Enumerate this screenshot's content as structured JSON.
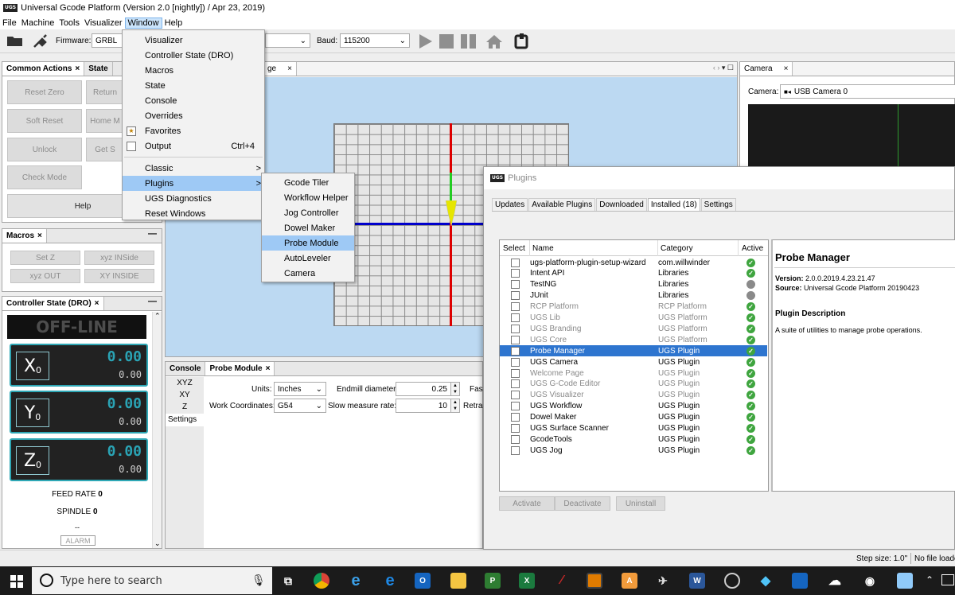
{
  "window": {
    "logo": "UGS",
    "title": "Universal Gcode Platform (Version 2.0 [nightly])  / Apr 23, 2019)"
  },
  "menubar": [
    "File",
    "Machine",
    "Tools",
    "Visualizer",
    "Window",
    "Help"
  ],
  "toolbar": {
    "firmware_label": "Firmware:",
    "firmware_value": "GRBL",
    "baud_label": "Baud:",
    "baud_value": "115200"
  },
  "common_actions": {
    "tab_label": "Common Actions",
    "tab2_label": "State",
    "buttons": [
      "Reset Zero",
      "Return",
      "Soft Reset",
      "Home M",
      "Unlock",
      "Get S",
      "Check Mode"
    ],
    "help_label": "Help"
  },
  "macros": {
    "tab_label": "Macros",
    "buttons": [
      "Set Z",
      "xyz INSide",
      "xyz OUT",
      "XY INSIDE"
    ]
  },
  "dro": {
    "tab_label": "Controller State (DRO)",
    "status": "OFF-LINE",
    "axes": [
      {
        "name": "X",
        "sub": "0",
        "work": "0.00",
        "machine": "0.00"
      },
      {
        "name": "Y",
        "sub": "0",
        "work": "0.00",
        "machine": "0.00"
      },
      {
        "name": "Z",
        "sub": "0",
        "work": "0.00",
        "machine": "0.00"
      }
    ],
    "feed_rate_label": "FEED RATE",
    "feed_rate_value": "0",
    "spindle_label": "SPINDLE",
    "spindle_value": "0",
    "dashes": "--",
    "alarm": "ALARM"
  },
  "window_menu": {
    "items": [
      {
        "label": "Visualizer"
      },
      {
        "label": "Controller State (DRO)"
      },
      {
        "label": "Macros"
      },
      {
        "label": "State"
      },
      {
        "label": "Console"
      },
      {
        "label": "Overrides"
      },
      {
        "label": "Favorites"
      },
      {
        "label": "Output",
        "shortcut": "Ctrl+4"
      },
      {
        "label": "Classic",
        "submenu": true
      },
      {
        "label": "Plugins",
        "submenu": true
      },
      {
        "label": "UGS Diagnostics"
      },
      {
        "label": "Reset Windows"
      }
    ],
    "submenu_arrow": ">"
  },
  "plugins_menu": [
    "Gcode Tiler",
    "Workflow Helper",
    "Jog Controller",
    "Dowel Maker",
    "Probe Module",
    "AutoLeveler",
    "Camera"
  ],
  "visualizer": {
    "tab_label": "ge"
  },
  "camera": {
    "tab_label": "Camera",
    "camera_label": "Camera:",
    "camera_value": "USB Camera 0"
  },
  "bottom_panel": {
    "tabs": [
      "Console",
      "Probe Module"
    ],
    "side_tabs": [
      "XYZ",
      "XY",
      "Z",
      "Settings"
    ],
    "units_label": "Units:",
    "units_value": "Inches",
    "endmill_label": "Endmill diameter:",
    "endmill_value": "0.25",
    "fast_label": "Fas",
    "workcoords_label": "Work Coordinates:",
    "workcoords_value": "G54",
    "slow_label": "Slow measure rate:",
    "slow_value": "10",
    "retract_label": "Retra"
  },
  "plugins_dialog": {
    "title": "Plugins",
    "tabs": [
      "Updates",
      "Available Plugins",
      "Downloaded",
      "Installed (18)",
      "Settings"
    ],
    "columns": [
      "Select",
      "Name",
      "Category",
      "Active"
    ],
    "rows": [
      {
        "name": "ugs-platform-plugin-setup-wizard",
        "category": "com.willwinder",
        "active": true,
        "dim": false
      },
      {
        "name": "Intent API",
        "category": "Libraries",
        "active": true,
        "dim": false
      },
      {
        "name": "TestNG",
        "category": "Libraries",
        "active": false,
        "dim": false
      },
      {
        "name": "JUnit",
        "category": "Libraries",
        "active": false,
        "dim": false
      },
      {
        "name": "RCP Platform",
        "category": "RCP Platform",
        "active": true,
        "dim": true
      },
      {
        "name": "UGS Lib",
        "category": "UGS Platform",
        "active": true,
        "dim": true
      },
      {
        "name": "UGS Branding",
        "category": "UGS Platform",
        "active": true,
        "dim": true
      },
      {
        "name": "UGS Core",
        "category": "UGS Platform",
        "active": true,
        "dim": true
      },
      {
        "name": "Probe Manager",
        "category": "UGS Plugin",
        "active": true,
        "dim": false
      },
      {
        "name": "UGS Camera",
        "category": "UGS Plugin",
        "active": true,
        "dim": false
      },
      {
        "name": "Welcome Page",
        "category": "UGS Plugin",
        "active": true,
        "dim": true
      },
      {
        "name": "UGS G-Code Editor",
        "category": "UGS Plugin",
        "active": true,
        "dim": true
      },
      {
        "name": "UGS Visualizer",
        "category": "UGS Plugin",
        "active": true,
        "dim": true
      },
      {
        "name": "UGS Workflow",
        "category": "UGS Plugin",
        "active": true,
        "dim": false
      },
      {
        "name": "Dowel Maker",
        "category": "UGS Plugin",
        "active": true,
        "dim": false
      },
      {
        "name": "UGS Surface Scanner",
        "category": "UGS Plugin",
        "active": true,
        "dim": false
      },
      {
        "name": "GcodeTools",
        "category": "UGS Plugin",
        "active": true,
        "dim": false
      },
      {
        "name": "UGS Jog",
        "category": "UGS Plugin",
        "active": true,
        "dim": false
      }
    ],
    "detail_title": "Probe Manager",
    "version_label": "Version:",
    "version_value": "2.0.0.2019.4.23.21.47",
    "source_label": "Source:",
    "source_value": "Universal Gcode Platform 20190423",
    "desc_heading": "Plugin Description",
    "desc_text": "A suite of utilities to manage probe operations.",
    "buttons": [
      "Activate",
      "Deactivate",
      "Uninstall"
    ]
  },
  "statusbar": {
    "step_size": "Step size: 1.0\"",
    "file": "No file loade"
  },
  "taskbar": {
    "search_placeholder": "Type here to search"
  }
}
